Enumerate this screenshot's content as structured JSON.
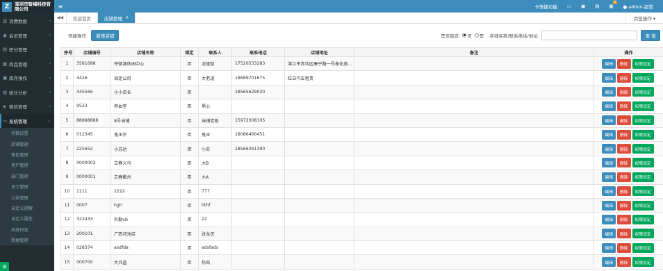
{
  "app": {
    "logo_mark": "Z",
    "company": "深圳市智络科技有限公司"
  },
  "sidebar": {
    "items": [
      {
        "label": "消费数据",
        "icon": "chart-icon"
      },
      {
        "label": "会员管理",
        "icon": "user-icon"
      },
      {
        "label": "积分管理",
        "icon": "points-icon"
      },
      {
        "label": "商品管理",
        "icon": "box-icon"
      },
      {
        "label": "库存操作",
        "icon": "stock-icon"
      },
      {
        "label": "统计分析",
        "icon": "stats-icon"
      },
      {
        "label": "微信管理",
        "icon": "wechat-icon"
      },
      {
        "label": "系统管理",
        "icon": "system-icon"
      }
    ],
    "subitems": [
      "参数设置",
      "店铺管理",
      "角色管理",
      "用户管理",
      "部门管理",
      "员工管理",
      "公告管理",
      "自定义提醒",
      "自定义属性",
      "系统日志",
      "数据管理"
    ],
    "corner": "按"
  },
  "topbar": {
    "menu_icon": "≡",
    "shortcut": "卡快捷功能",
    "badge": "0",
    "user": "admin-超管"
  },
  "tabs": {
    "prev": "◀◀",
    "items": [
      "欢迎首页",
      "店铺管理"
    ],
    "close": "×",
    "page_ops": "页签操作 ▾"
  },
  "toolbar": {
    "quick_label": "快捷操作:",
    "add_label": "新增店铺",
    "lock_label": "是否锁定:",
    "radio_no": "否",
    "radio_yes": "是",
    "search_label": "店铺名称/联系电话/地址:",
    "search_value": "",
    "query_label": "查 询"
  },
  "table": {
    "headers": [
      "序号",
      "店铺编号",
      "店铺名称",
      "锁定",
      "联系人",
      "联系电话",
      "店铺地址",
      "备注",
      "操作"
    ],
    "edit_label": "编辑",
    "delete_label": "删除",
    "perm_label": "权限设定",
    "rows": [
      {
        "no": "1",
        "code": "3581688",
        "name": "帝御演休闲中心",
        "locked": "否",
        "contact": "龙隆智",
        "phone": "17520533283",
        "address": "湛江市赤坎区康宁路一号泰化美…",
        "remark": ""
      },
      {
        "no": "2",
        "code": "4426",
        "name": "海定公司",
        "locked": "否",
        "contact": "大老道",
        "phone": "18689701675",
        "address": "红日汽车租赁",
        "remark": ""
      },
      {
        "no": "3",
        "code": "445566",
        "name": "小小店长",
        "locked": "否",
        "contact": "",
        "phone": "18565629030",
        "address": "",
        "remark": ""
      },
      {
        "no": "4",
        "code": "9523",
        "name": "养血堂",
        "locked": "否",
        "contact": "黑心",
        "phone": "",
        "address": "",
        "remark": ""
      },
      {
        "no": "5",
        "code": "88888888",
        "name": "8号当铺",
        "locked": "否",
        "contact": "当铺老板",
        "phone": "15972308105",
        "address": "",
        "remark": ""
      },
      {
        "no": "6",
        "code": "012345",
        "name": "鬼王宗",
        "locked": "否",
        "contact": "鬼王",
        "phone": "18086460451",
        "address": "",
        "remark": ""
      },
      {
        "no": "7",
        "code": "225652",
        "name": "小苏达",
        "locked": "否",
        "contact": "小苏",
        "phone": "18566261390",
        "address": "",
        "remark": ""
      },
      {
        "no": "8",
        "code": "0000003",
        "name": "立春义乌",
        "locked": "否",
        "contact": "大B",
        "phone": "",
        "address": "",
        "remark": ""
      },
      {
        "no": "9",
        "code": "0000001",
        "name": "立春衢州",
        "locked": "否",
        "contact": "大A",
        "phone": "",
        "address": "",
        "remark": ""
      },
      {
        "no": "10",
        "code": "1111",
        "name": "2222",
        "locked": "否",
        "contact": "777",
        "phone": "",
        "address": "",
        "remark": ""
      },
      {
        "no": "11",
        "code": "0007",
        "name": "hgh",
        "locked": "否",
        "contact": "hthf",
        "phone": "",
        "address": "",
        "remark": ""
      },
      {
        "no": "12",
        "code": "323433",
        "name": "外勤vb",
        "locked": "否",
        "contact": "22",
        "phone": "",
        "address": "",
        "remark": ""
      },
      {
        "no": "13",
        "code": "200101",
        "name": "广西河池店",
        "locked": "否",
        "contact": "张龙庆",
        "phone": "",
        "address": "",
        "remark": ""
      },
      {
        "no": "14",
        "code": "028374",
        "name": "asdfda",
        "locked": "否",
        "contact": "adsfads",
        "phone": "",
        "address": "",
        "remark": ""
      },
      {
        "no": "15",
        "code": "000700",
        "name": "大兵盗",
        "locked": "否",
        "contact": "热风",
        "phone": "",
        "address": "",
        "remark": ""
      }
    ]
  }
}
